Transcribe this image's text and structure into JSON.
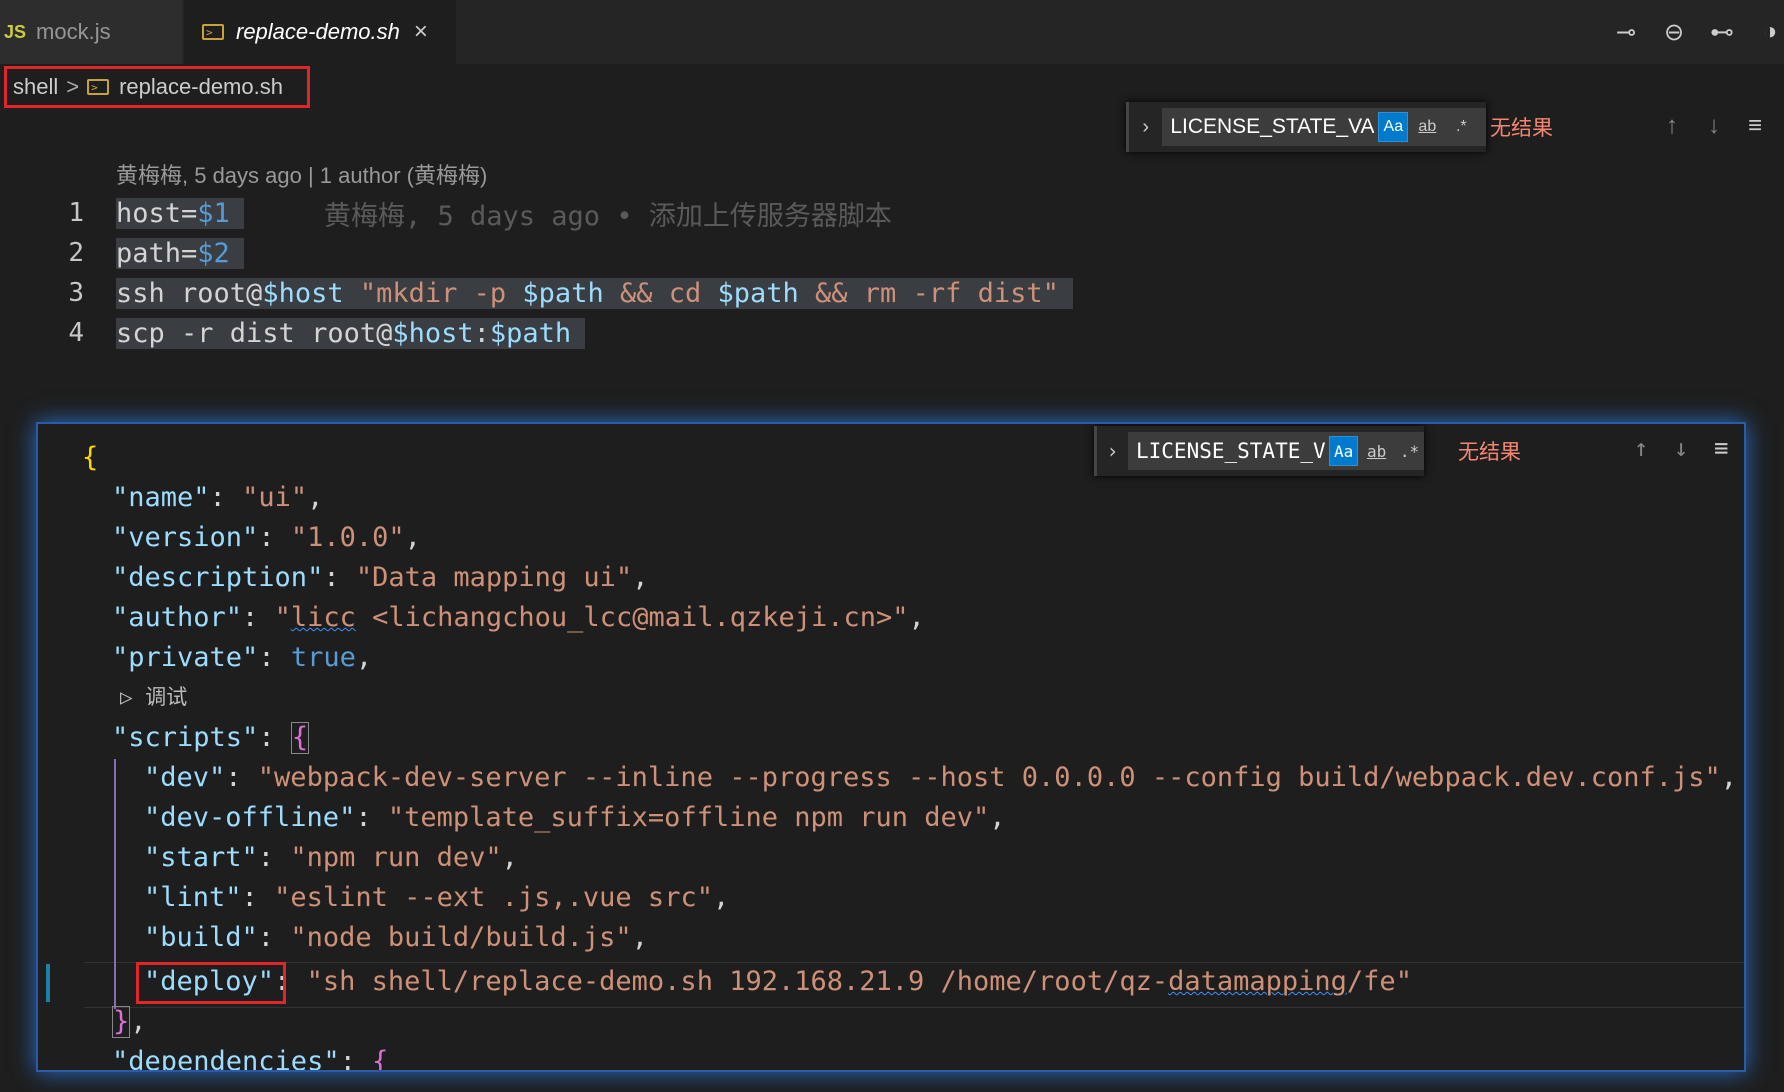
{
  "tabs": [
    {
      "icon": "JS",
      "label": "mock.js"
    },
    {
      "label": "replace-demo.sh",
      "close": "×"
    }
  ],
  "breadcrumb": {
    "folder": "shell",
    "separator": ">",
    "file": "replace-demo.sh"
  },
  "find_widget": {
    "query": "LICENSE_STATE_VA",
    "options": {
      "match_case": "Aa",
      "whole_word": "ab",
      "regex": ".*"
    },
    "result": "无结果",
    "prev": "↑",
    "next": "↓",
    "menu": "≡"
  },
  "blame": {
    "header": "黄梅梅, 5 days ago | 1 author (黄梅梅)",
    "inline": "黄梅梅, 5 days ago • 添加上传服务器脚本"
  },
  "shell_lines": [
    {
      "num": "1",
      "text": "host=$1"
    },
    {
      "num": "2",
      "text": "path=$2"
    },
    {
      "num": "3",
      "text": "ssh root@$host \"mkdir -p $path && cd $path && rm -rf dist\""
    },
    {
      "num": "4",
      "text": "scp -r dist root@$host:$path"
    }
  ],
  "package_json": {
    "open": "{",
    "name_key": "\"name\"",
    "name_val": "\"ui\"",
    "version_key": "\"version\"",
    "version_val": "\"1.0.0\"",
    "description_key": "\"description\"",
    "description_val": "\"Data mapping ui\"",
    "author_key": "\"author\"",
    "author_q": "\"",
    "author_name": "licc",
    "author_rest": " <lichangchou_lcc@mail.qzkeji.cn>\"",
    "private_key": "\"private\"",
    "private_val": "true",
    "codelens": "调试",
    "scripts_key": "\"scripts\"",
    "scripts": [
      {
        "key": "\"dev\"",
        "val": "\"webpack-dev-server --inline --progress --host 0.0.0.0 --config build/webpack.dev.conf.js\""
      },
      {
        "key": "\"dev-offline\"",
        "val": "\"template_suffix=offline npm run dev\""
      },
      {
        "key": "\"start\"",
        "val": "\"npm run dev\""
      },
      {
        "key": "\"lint\"",
        "val": "\"eslint --ext .js,.vue src\""
      },
      {
        "key": "\"build\"",
        "val": "\"node build/build.js\""
      }
    ],
    "deploy_key": "\"deploy\"",
    "deploy_val_a": "\"sh shell/replace-demo.sh 192.168.21.9 /home/root/qz-",
    "deploy_val_b": "datamapping",
    "deploy_val_c": "/fe\"",
    "close_scripts": "}",
    "dependencies_key": "\"dependencies\""
  }
}
